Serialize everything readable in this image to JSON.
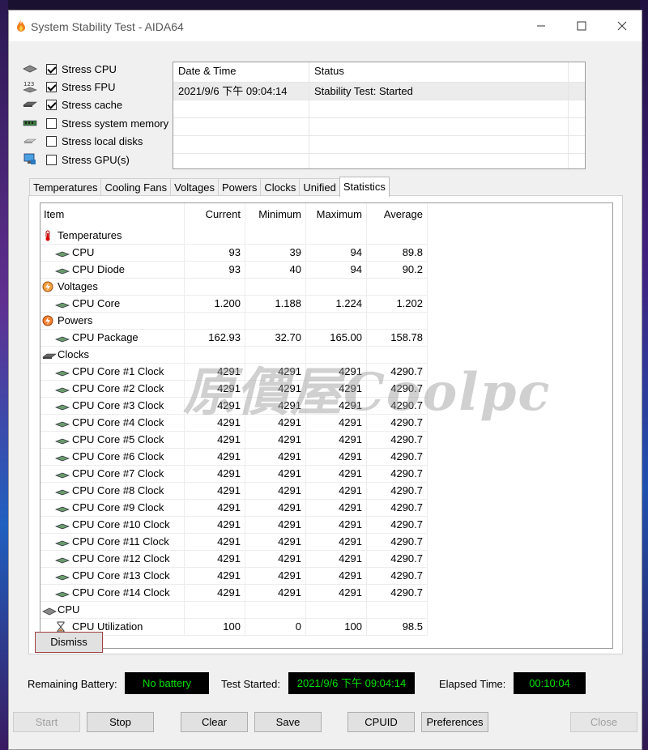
{
  "window": {
    "title": "System Stability Test - AIDA64"
  },
  "stress_options": [
    {
      "label": "Stress CPU",
      "checked": true,
      "icon": "cpu-chip-icon"
    },
    {
      "label": "Stress FPU",
      "checked": true,
      "icon": "fpu-123-icon"
    },
    {
      "label": "Stress cache",
      "checked": true,
      "icon": "cache-chip-icon"
    },
    {
      "label": "Stress system memory",
      "checked": false,
      "icon": "memory-module-icon"
    },
    {
      "label": "Stress local disks",
      "checked": false,
      "icon": "disk-drive-icon"
    },
    {
      "label": "Stress GPU(s)",
      "checked": false,
      "icon": "monitor-icon"
    }
  ],
  "log": {
    "headers": [
      "Date & Time",
      "Status"
    ],
    "rows": [
      {
        "datetime": "2021/9/6 下午 09:04:14",
        "status": "Stability Test: Started"
      }
    ]
  },
  "tabs": [
    "Temperatures",
    "Cooling Fans",
    "Voltages",
    "Powers",
    "Clocks",
    "Unified",
    "Statistics"
  ],
  "active_tab": "Statistics",
  "stats": {
    "headers": [
      "Item",
      "Current",
      "Minimum",
      "Maximum",
      "Average"
    ],
    "rows": [
      {
        "group": true,
        "item": "Temperatures",
        "icon": "thermometer-icon"
      },
      {
        "item": "CPU",
        "current": "93",
        "min": "39",
        "max": "94",
        "avg": "89.8"
      },
      {
        "item": "CPU Diode",
        "current": "93",
        "min": "40",
        "max": "94",
        "avg": "90.2"
      },
      {
        "group": true,
        "item": "Voltages",
        "icon": "voltage-icon"
      },
      {
        "item": "CPU Core",
        "current": "1.200",
        "min": "1.188",
        "max": "1.224",
        "avg": "1.202"
      },
      {
        "group": true,
        "item": "Powers",
        "icon": "power-icon"
      },
      {
        "item": "CPU Package",
        "current": "162.93",
        "min": "32.70",
        "max": "165.00",
        "avg": "158.78"
      },
      {
        "group": true,
        "item": "Clocks",
        "icon": "clock-chip-icon"
      },
      {
        "item": "CPU Core #1 Clock",
        "current": "4291",
        "min": "4291",
        "max": "4291",
        "avg": "4290.7"
      },
      {
        "item": "CPU Core #2 Clock",
        "current": "4291",
        "min": "4291",
        "max": "4291",
        "avg": "4290.7"
      },
      {
        "item": "CPU Core #3 Clock",
        "current": "4291",
        "min": "4291",
        "max": "4291",
        "avg": "4290.7"
      },
      {
        "item": "CPU Core #4 Clock",
        "current": "4291",
        "min": "4291",
        "max": "4291",
        "avg": "4290.7"
      },
      {
        "item": "CPU Core #5 Clock",
        "current": "4291",
        "min": "4291",
        "max": "4291",
        "avg": "4290.7"
      },
      {
        "item": "CPU Core #6 Clock",
        "current": "4291",
        "min": "4291",
        "max": "4291",
        "avg": "4290.7"
      },
      {
        "item": "CPU Core #7 Clock",
        "current": "4291",
        "min": "4291",
        "max": "4291",
        "avg": "4290.7"
      },
      {
        "item": "CPU Core #8 Clock",
        "current": "4291",
        "min": "4291",
        "max": "4291",
        "avg": "4290.7"
      },
      {
        "item": "CPU Core #9 Clock",
        "current": "4291",
        "min": "4291",
        "max": "4291",
        "avg": "4290.7"
      },
      {
        "item": "CPU Core #10 Clock",
        "current": "4291",
        "min": "4291",
        "max": "4291",
        "avg": "4290.7"
      },
      {
        "item": "CPU Core #11 Clock",
        "current": "4291",
        "min": "4291",
        "max": "4291",
        "avg": "4290.7"
      },
      {
        "item": "CPU Core #12 Clock",
        "current": "4291",
        "min": "4291",
        "max": "4291",
        "avg": "4290.7"
      },
      {
        "item": "CPU Core #13 Clock",
        "current": "4291",
        "min": "4291",
        "max": "4291",
        "avg": "4290.7"
      },
      {
        "item": "CPU Core #14 Clock",
        "current": "4291",
        "min": "4291",
        "max": "4291",
        "avg": "4290.7"
      },
      {
        "group": true,
        "item": "CPU",
        "icon": "cpu-chip-icon"
      },
      {
        "item": "CPU Utilization",
        "current": "100",
        "min": "0",
        "max": "100",
        "avg": "98.5",
        "sub_icon": "hourglass-icon"
      }
    ]
  },
  "dismiss_label": "Dismiss",
  "status": {
    "battery_label": "Remaining Battery:",
    "battery_value": "No battery",
    "started_label": "Test Started:",
    "started_value": "2021/9/6 下午 09:04:14",
    "elapsed_label": "Elapsed Time:",
    "elapsed_value": "00:10:04"
  },
  "buttons": {
    "start": "Start",
    "stop": "Stop",
    "clear": "Clear",
    "save": "Save",
    "cpuid": "CPUID",
    "preferences": "Preferences",
    "close": "Close"
  },
  "watermark": "原價屋Coolpc",
  "colors": {
    "status_bg": "#000000",
    "status_fg": "#00e000",
    "dismiss_border": "#a04040"
  }
}
